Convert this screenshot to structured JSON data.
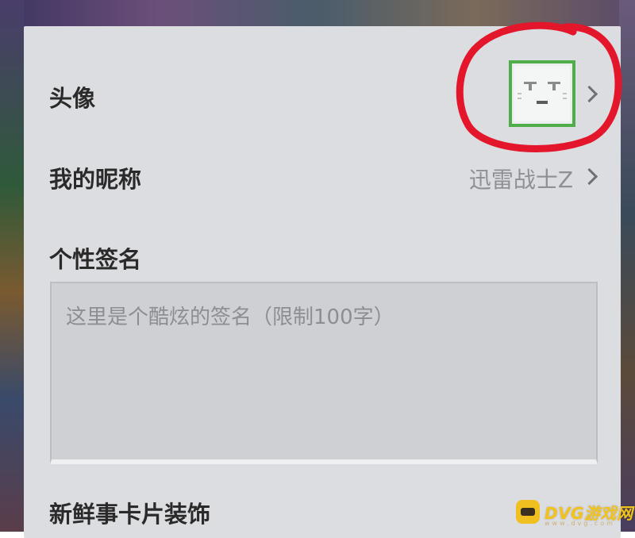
{
  "profile": {
    "avatar_label": "头像",
    "nickname_label": "我的昵称",
    "nickname_value": "迅雷战士Z",
    "signature_label": "个性签名",
    "signature_placeholder": "这里是个酷炫的签名（限制100字）",
    "card_decoration_label": "新鲜事卡片装饰"
  },
  "watermark": {
    "text": "DVG游戏网",
    "subtext": "www.dvg.com"
  },
  "icons": {
    "avatar_row_chevron": "chevron-right-icon",
    "nickname_row_chevron": "chevron-right-icon",
    "watermark_logo": "gamepad-icon"
  },
  "colors": {
    "panel_background": "#dcdde0",
    "avatar_border": "#4fae4a",
    "annotation_circle": "#e4162b",
    "watermark": "#f2c31a"
  }
}
